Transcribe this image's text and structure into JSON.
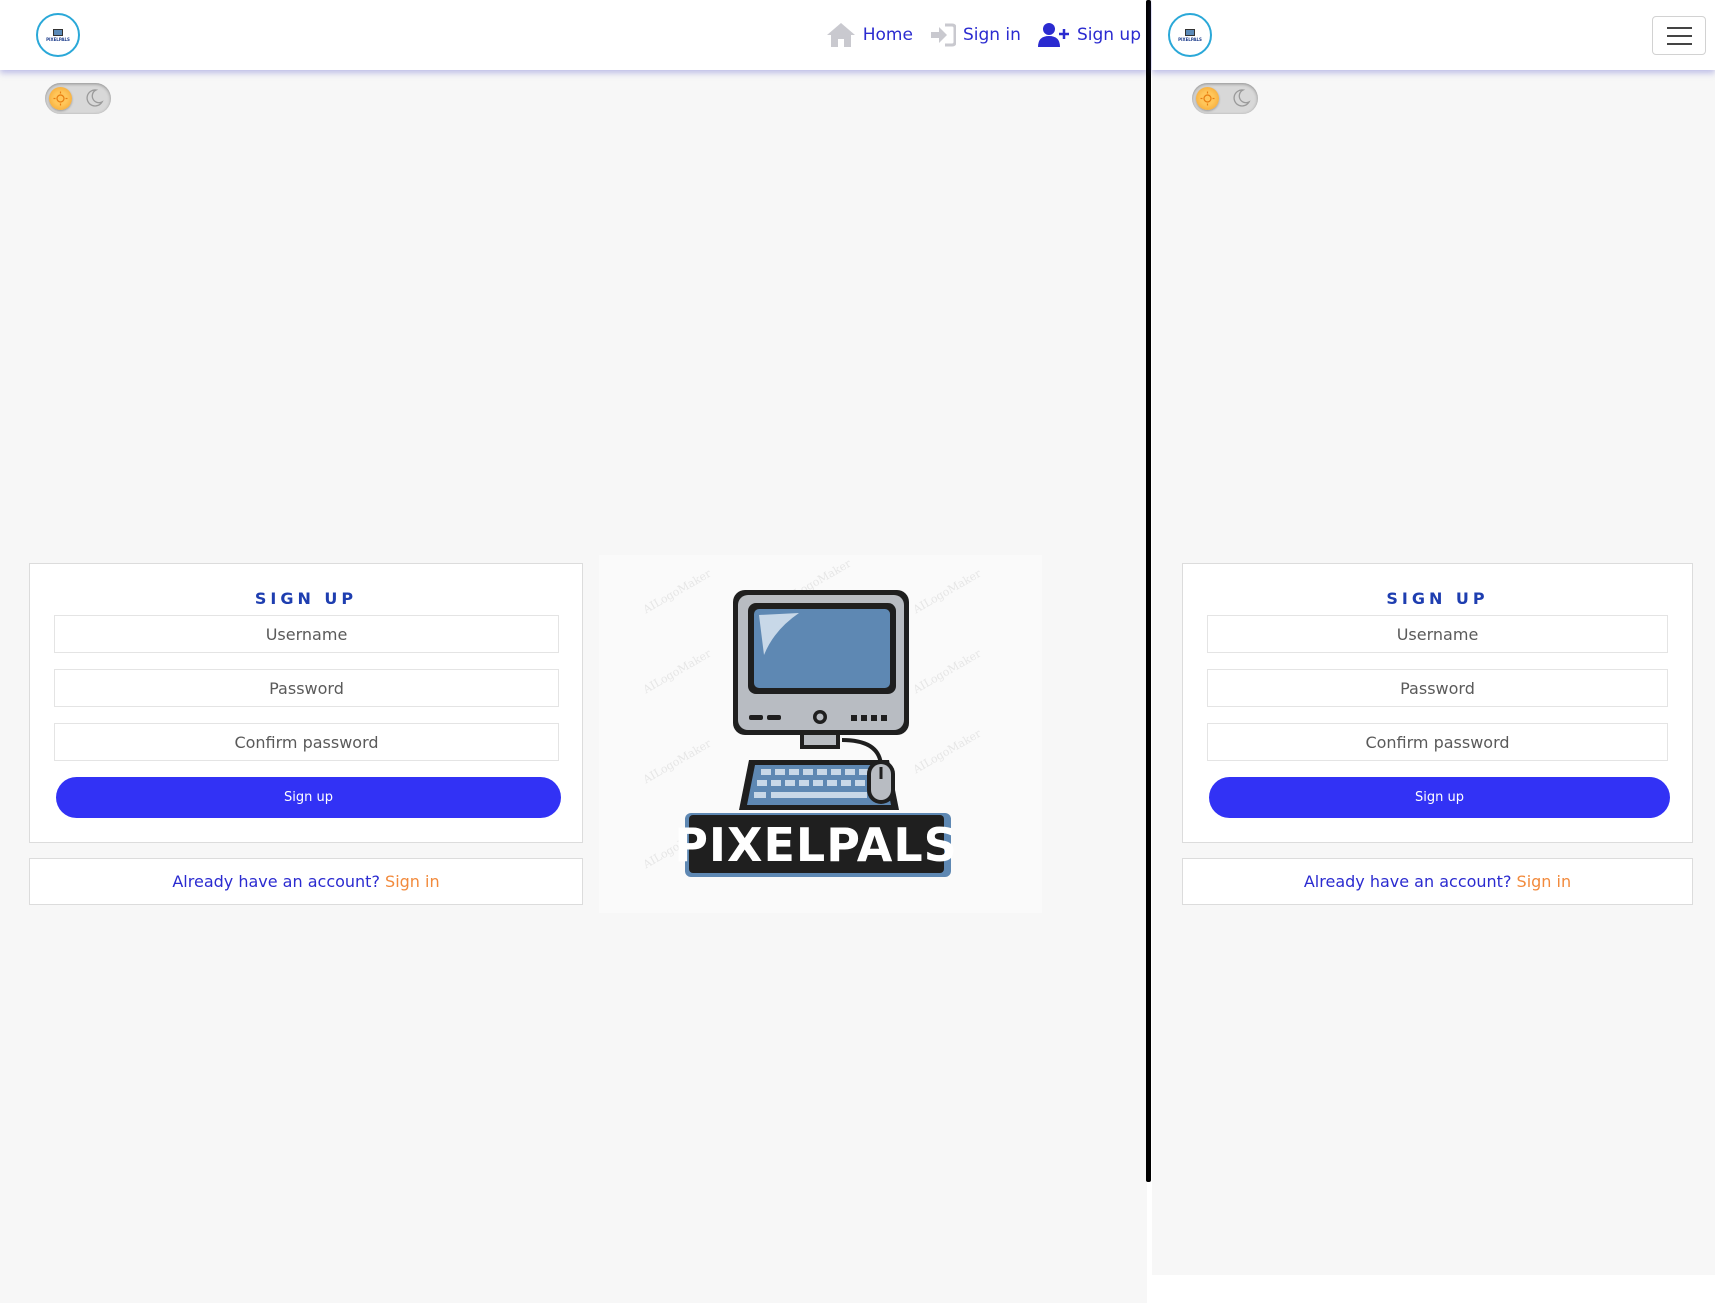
{
  "brand": {
    "logo_text": "PIXELPALS",
    "image_text": "PIXELPALS",
    "watermark": "AILogoMaker"
  },
  "nav": {
    "home_label": "Home",
    "signin_label": "Sign in",
    "signup_label": "Sign up"
  },
  "theme_toggle": {
    "mode": "light",
    "sun_icon": "sun-icon",
    "moon_icon": "moon-icon"
  },
  "signup_form": {
    "title": "SIGN UP",
    "username_placeholder": "Username",
    "password_placeholder": "Password",
    "confirm_placeholder": "Confirm password",
    "submit_label": "Sign up"
  },
  "signin_prompt": {
    "text": "Already have an account?",
    "link_label": "Sign in"
  },
  "colors": {
    "accent": "#3232f5",
    "link": "#2b2bd0",
    "title": "#1e3eb0",
    "highlight": "#f28a3c",
    "background": "#f7f7f7"
  }
}
